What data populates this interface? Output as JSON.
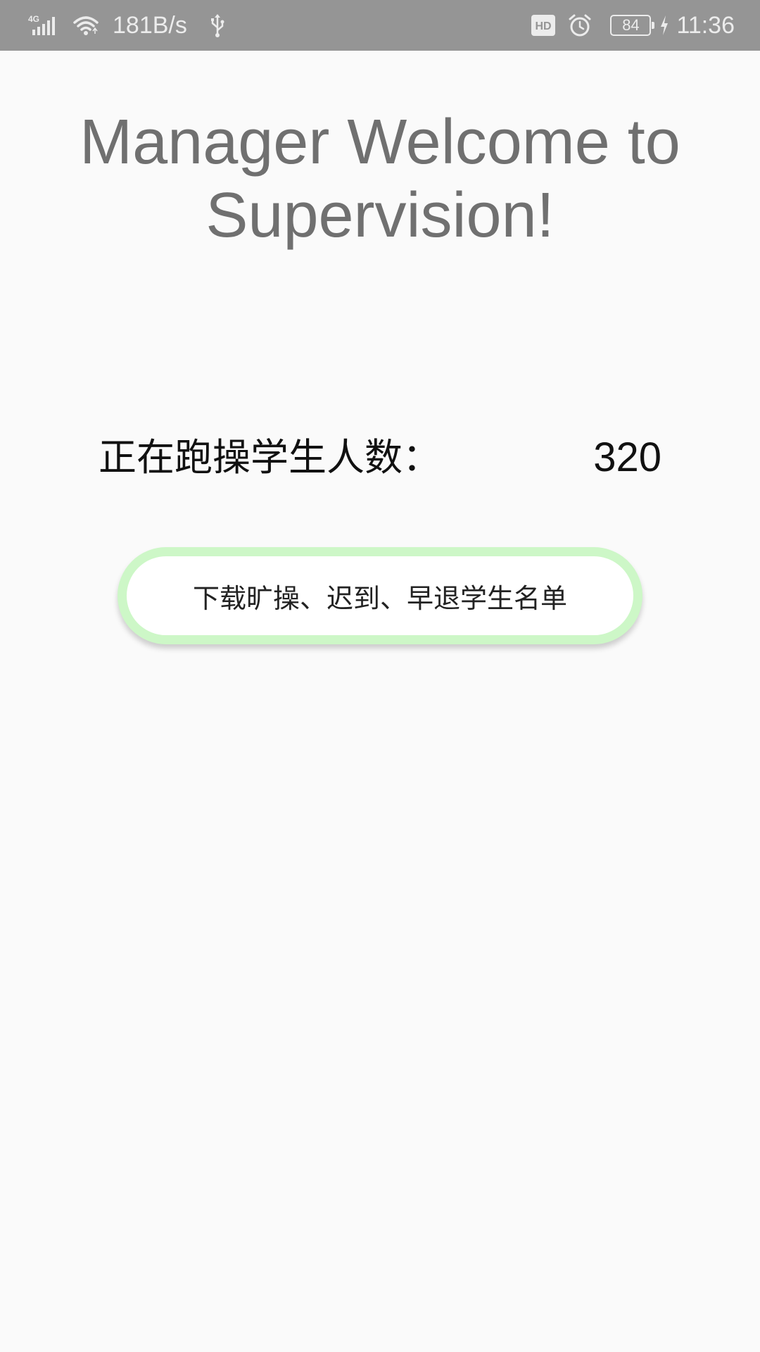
{
  "status_bar": {
    "network_type": "4G",
    "speed": "181B/s",
    "hd_badge": "HD",
    "battery_level": "84",
    "time": "11:36",
    "icons": [
      "signal-icon",
      "wifi-icon",
      "usb-icon",
      "hd-icon",
      "alarm-icon",
      "battery-icon",
      "charging-icon"
    ]
  },
  "main": {
    "title": "Manager Welcome to Supervision!",
    "count_label": "正在跑操学生人数：",
    "count_value": "320",
    "download_button_label": "下载旷操、迟到、早退学生名单"
  },
  "colors": {
    "status_bar_bg": "#959595",
    "page_bg": "#fafafa",
    "title_text": "#707070",
    "button_border": "#cdf7c7"
  }
}
